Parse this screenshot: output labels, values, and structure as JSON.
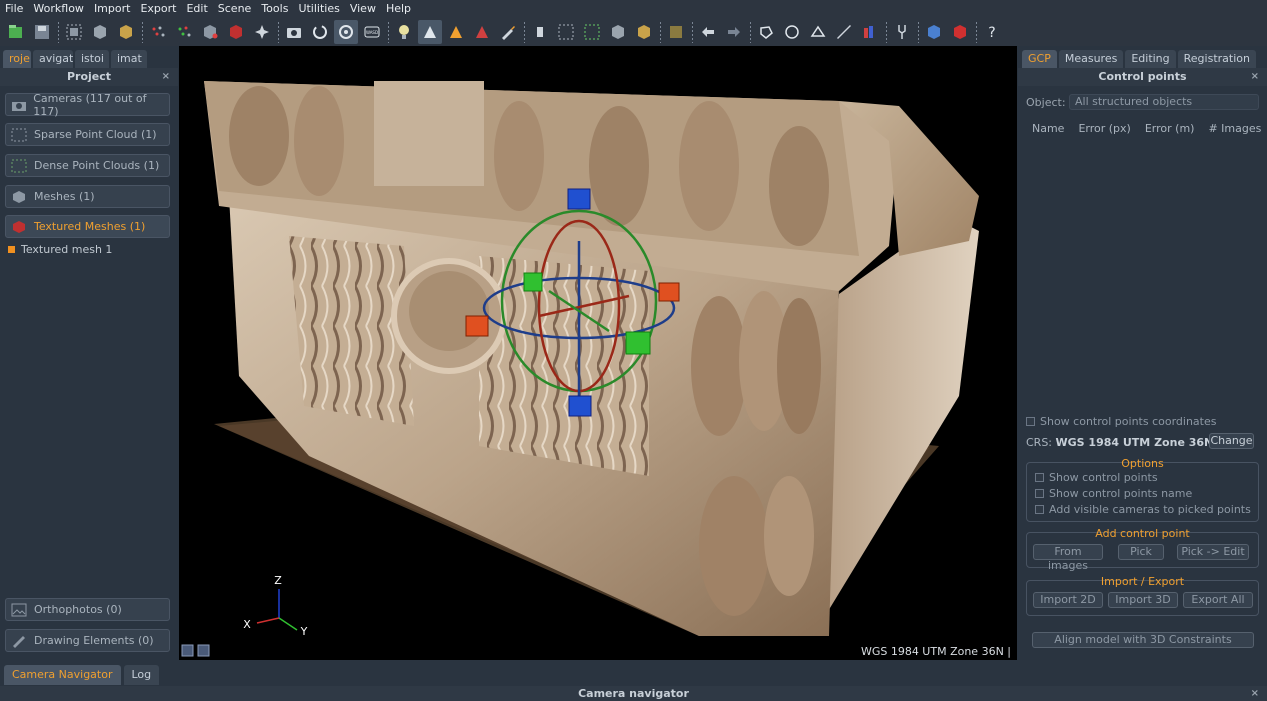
{
  "menu": [
    "File",
    "Workflow",
    "Import",
    "Export",
    "Edit",
    "Scene",
    "Tools",
    "Utilities",
    "View",
    "Help"
  ],
  "left_tabs": [
    "roje",
    "avigat",
    "istoi",
    "imat"
  ],
  "project": {
    "title": "Project",
    "items": [
      "Cameras (117 out of 117)",
      "Sparse Point Cloud (1)",
      "Dense Point Clouds (1)",
      "Meshes (1)",
      "Textured Meshes (1)"
    ],
    "tree_item": "Textured mesh 1",
    "bottom_items": [
      "Orthophotos (0)",
      "Drawing Elements (0)"
    ]
  },
  "viewport": {
    "status": "WGS 1984 UTM Zone 36N |",
    "axes": {
      "x": "X",
      "y": "Y",
      "z": "Z"
    }
  },
  "right_tabs": [
    "GCP",
    "Measures",
    "Editing",
    "Registration"
  ],
  "gcp": {
    "title": "Control points",
    "object_label": "Object:",
    "object_value": "All structured objects",
    "columns": [
      "Name",
      "Error (px)",
      "Error (m)",
      "# Images"
    ],
    "show_coords": "Show control points coordinates",
    "crs_label": "CRS:",
    "crs_value": "WGS 1984 UTM Zone 36N",
    "change": "Change",
    "options_title": "Options",
    "options": [
      "Show control points",
      "Show control points name",
      "Add visible cameras to picked points"
    ],
    "add_title": "Add control point",
    "add_buttons": [
      "From images",
      "Pick",
      "Pick -> Edit"
    ],
    "ie_title": "Import / Export",
    "ie_buttons": [
      "Import 2D",
      "Import 3D",
      "Export All"
    ],
    "align": "Align model with 3D Constraints"
  },
  "bottom": {
    "tabs": [
      "Camera Navigator",
      "Log"
    ],
    "title": "Camera navigator"
  },
  "colors": {
    "accent": "#f0a030",
    "panel": "#2a3440"
  }
}
